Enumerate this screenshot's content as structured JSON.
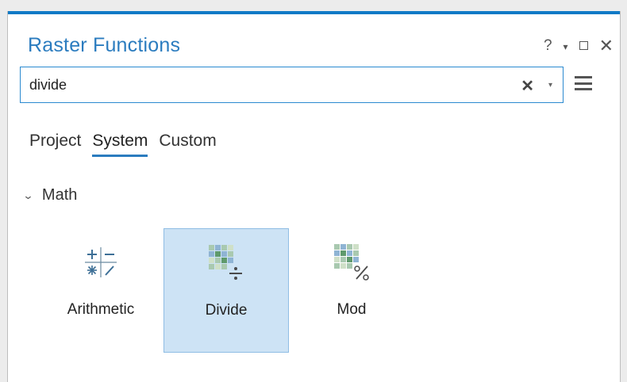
{
  "pane": {
    "title": "Raster Functions",
    "controls": {
      "help": "?",
      "dropdown": "▾",
      "close": "✕"
    }
  },
  "search": {
    "value": "divide",
    "clear": "✕",
    "dropdown": "▾"
  },
  "tabs": [
    {
      "label": "Project",
      "active": false
    },
    {
      "label": "System",
      "active": true
    },
    {
      "label": "Custom",
      "active": false
    }
  ],
  "group": {
    "label": "Math",
    "expanded": true
  },
  "functions": [
    {
      "label": "Arithmetic",
      "icon": "arithmetic-icon",
      "selected": false
    },
    {
      "label": "Divide",
      "icon": "divide-icon",
      "selected": true
    },
    {
      "label": "Mod",
      "icon": "mod-icon",
      "selected": false
    }
  ],
  "colors": {
    "accent": "#2b7cbf",
    "selected_bg": "#cde3f5",
    "selected_border": "#8fbde4",
    "top_bar": "#0f7ac6"
  }
}
